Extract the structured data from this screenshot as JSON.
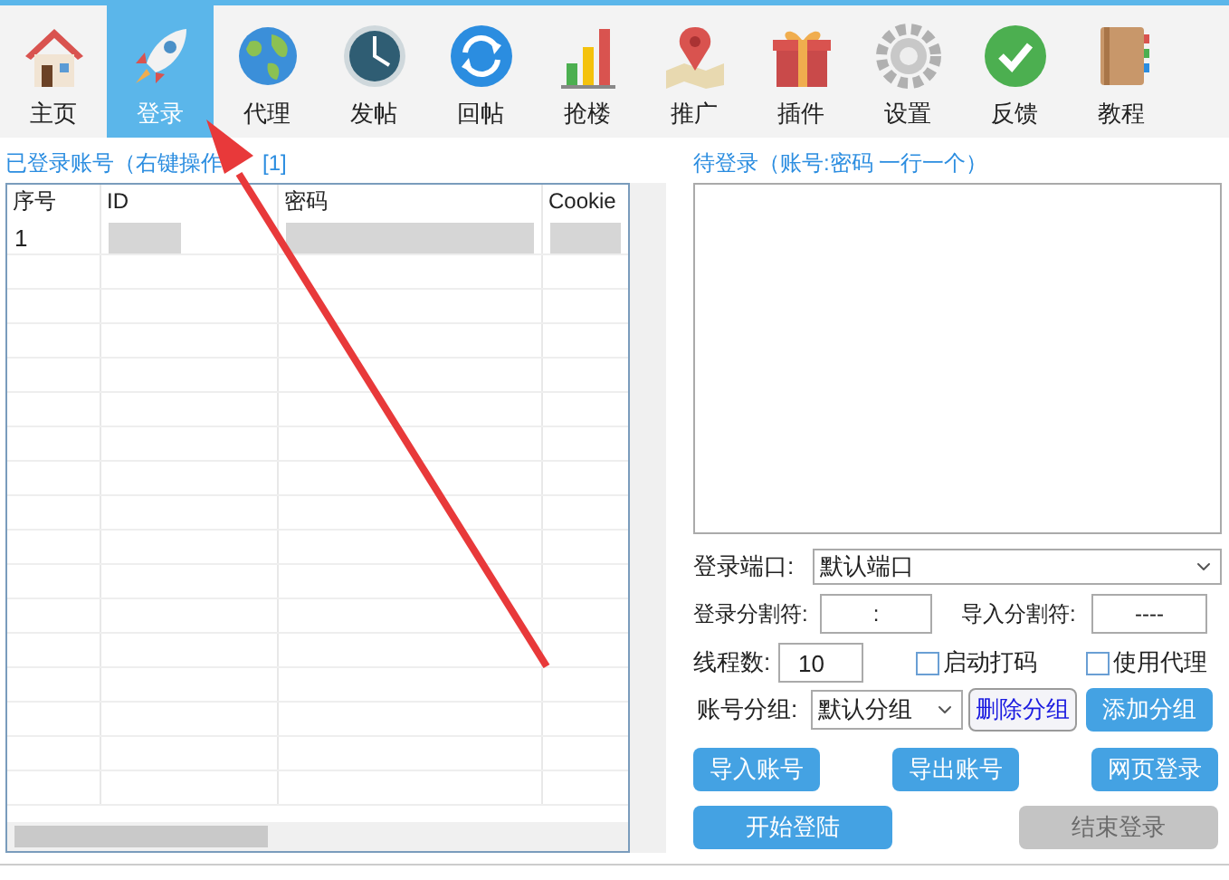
{
  "toolbar": [
    {
      "label": "主页",
      "selected": false
    },
    {
      "label": "登录",
      "selected": true
    },
    {
      "label": "代理",
      "selected": false
    },
    {
      "label": "发帖",
      "selected": false
    },
    {
      "label": "回帖",
      "selected": false
    },
    {
      "label": "抢楼",
      "selected": false
    },
    {
      "label": "推广",
      "selected": false
    },
    {
      "label": "插件",
      "selected": false
    },
    {
      "label": "设置",
      "selected": false
    },
    {
      "label": "反馈",
      "selected": false
    },
    {
      "label": "教程",
      "selected": false
    }
  ],
  "logged_in": {
    "title": "已登录账号（右键操作",
    "count": "[1]",
    "columns": [
      "序号",
      "ID",
      "密码",
      "Cookie"
    ],
    "rows": [
      {
        "index": "1",
        "redacted": true
      }
    ]
  },
  "pending": {
    "title": "待登录（账号:密码 一行一个）"
  },
  "form": {
    "port_label": "登录端口:",
    "port_value": "默认端口",
    "login_sep_label": "登录分割符:",
    "login_sep_value": ":",
    "import_sep_label": "导入分割符:",
    "import_sep_value": "----",
    "threads_label": "线程数:",
    "threads_value": "10",
    "captcha": {
      "label": "启动打码",
      "checked": false
    },
    "proxy": {
      "label": "使用代理",
      "checked": false
    },
    "group_label": "账号分组:",
    "group_value": "默认分组",
    "group_buttons": [
      {
        "label": "删除分组",
        "kind": "outline"
      },
      {
        "label": "添加分组",
        "kind": "primary"
      }
    ]
  },
  "buttons": [
    {
      "label": "导入账号",
      "disabled": false
    },
    {
      "label": "导出账号",
      "disabled": false
    },
    {
      "label": "网页登录",
      "disabled": false
    }
  ],
  "bottom_buttons": [
    {
      "label": "开始登陆",
      "disabled": false
    },
    {
      "label": "结束登录",
      "disabled": true
    }
  ]
}
